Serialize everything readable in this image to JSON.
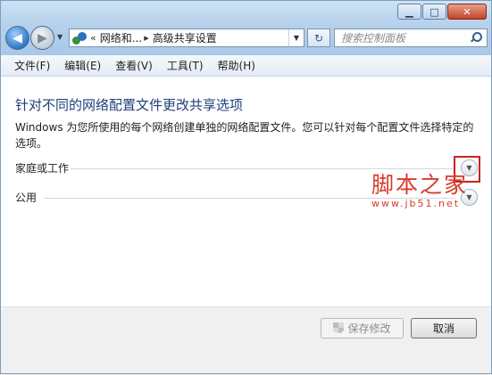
{
  "window": {
    "caption_buttons": {
      "minimize": "▁",
      "maximize": "□",
      "close": "✕"
    }
  },
  "nav": {
    "back_icon": "back-arrow-icon",
    "forward_icon": "forward-arrow-icon",
    "address": {
      "separator": "«",
      "parts": [
        "网络和...",
        "高级共享设置"
      ],
      "path_separator": "▸"
    },
    "search_placeholder": "搜索控制面板"
  },
  "menu": [
    "文件(F)",
    "编辑(E)",
    "查看(V)",
    "工具(T)",
    "帮助(H)"
  ],
  "content": {
    "title": "针对不同的网络配置文件更改共享选项",
    "description": "Windows 为您所使用的每个网络创建单独的网络配置文件。您可以针对每个配置文件选择特定的选项。",
    "sections": [
      {
        "label": "家庭或工作",
        "expanded": false
      },
      {
        "label": "公用",
        "expanded": false
      }
    ]
  },
  "watermark": {
    "text": "脚本之家",
    "url": "www.jb51.net"
  },
  "footer": {
    "save_label": "保存修改",
    "cancel_label": "取消"
  },
  "colors": {
    "title_blue": "#1e3f79",
    "highlight_red": "#cc2222",
    "watermark_red": "#d93a2b"
  }
}
